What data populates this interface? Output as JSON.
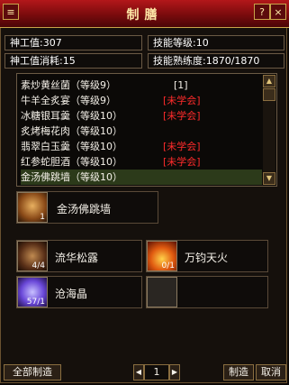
{
  "window": {
    "title": "制膳"
  },
  "stats": {
    "value_label": "神工值:307",
    "value_cost_label": "神工值消耗:15",
    "skill_level_label": "技能等级:10",
    "skill_proficiency_label": "技能熟练度:1870/1870"
  },
  "recipes": [
    {
      "name": "素炒黄丝菌（等级9）",
      "status": "",
      "count": "[1]"
    },
    {
      "name": "牛羊全炙宴（等级9）",
      "status": "[未学会]",
      "count": ""
    },
    {
      "name": "冰糖银耳羹（等级10）",
      "status": "[未学会]",
      "count": ""
    },
    {
      "name": "炙烤梅花肉（等级10）",
      "status": "",
      "count": ""
    },
    {
      "name": "翡翠白玉羹（等级10）",
      "status": "[未学会]",
      "count": ""
    },
    {
      "name": "红参蛇胆酒（等级10）",
      "status": "[未学会]",
      "count": ""
    },
    {
      "name": "金汤佛跳墙（等级10）",
      "status": "",
      "count": ""
    }
  ],
  "product": {
    "name": "金汤佛跳墙",
    "qty": "1"
  },
  "materials": [
    {
      "name": "流华松露",
      "qty": "4/4"
    },
    {
      "name": "万钧天火",
      "qty": "0/1"
    },
    {
      "name": "沧海晶",
      "qty": "57/1"
    }
  ],
  "footer": {
    "make_all": "全部制造",
    "quantity": "1",
    "make": "制造",
    "cancel": "取消"
  },
  "colors": {
    "title_bar": "#9b1214",
    "unlearned": "#ff2b2b",
    "selected_row": "#2c3a1a",
    "border_gold": "#c9a44a"
  }
}
